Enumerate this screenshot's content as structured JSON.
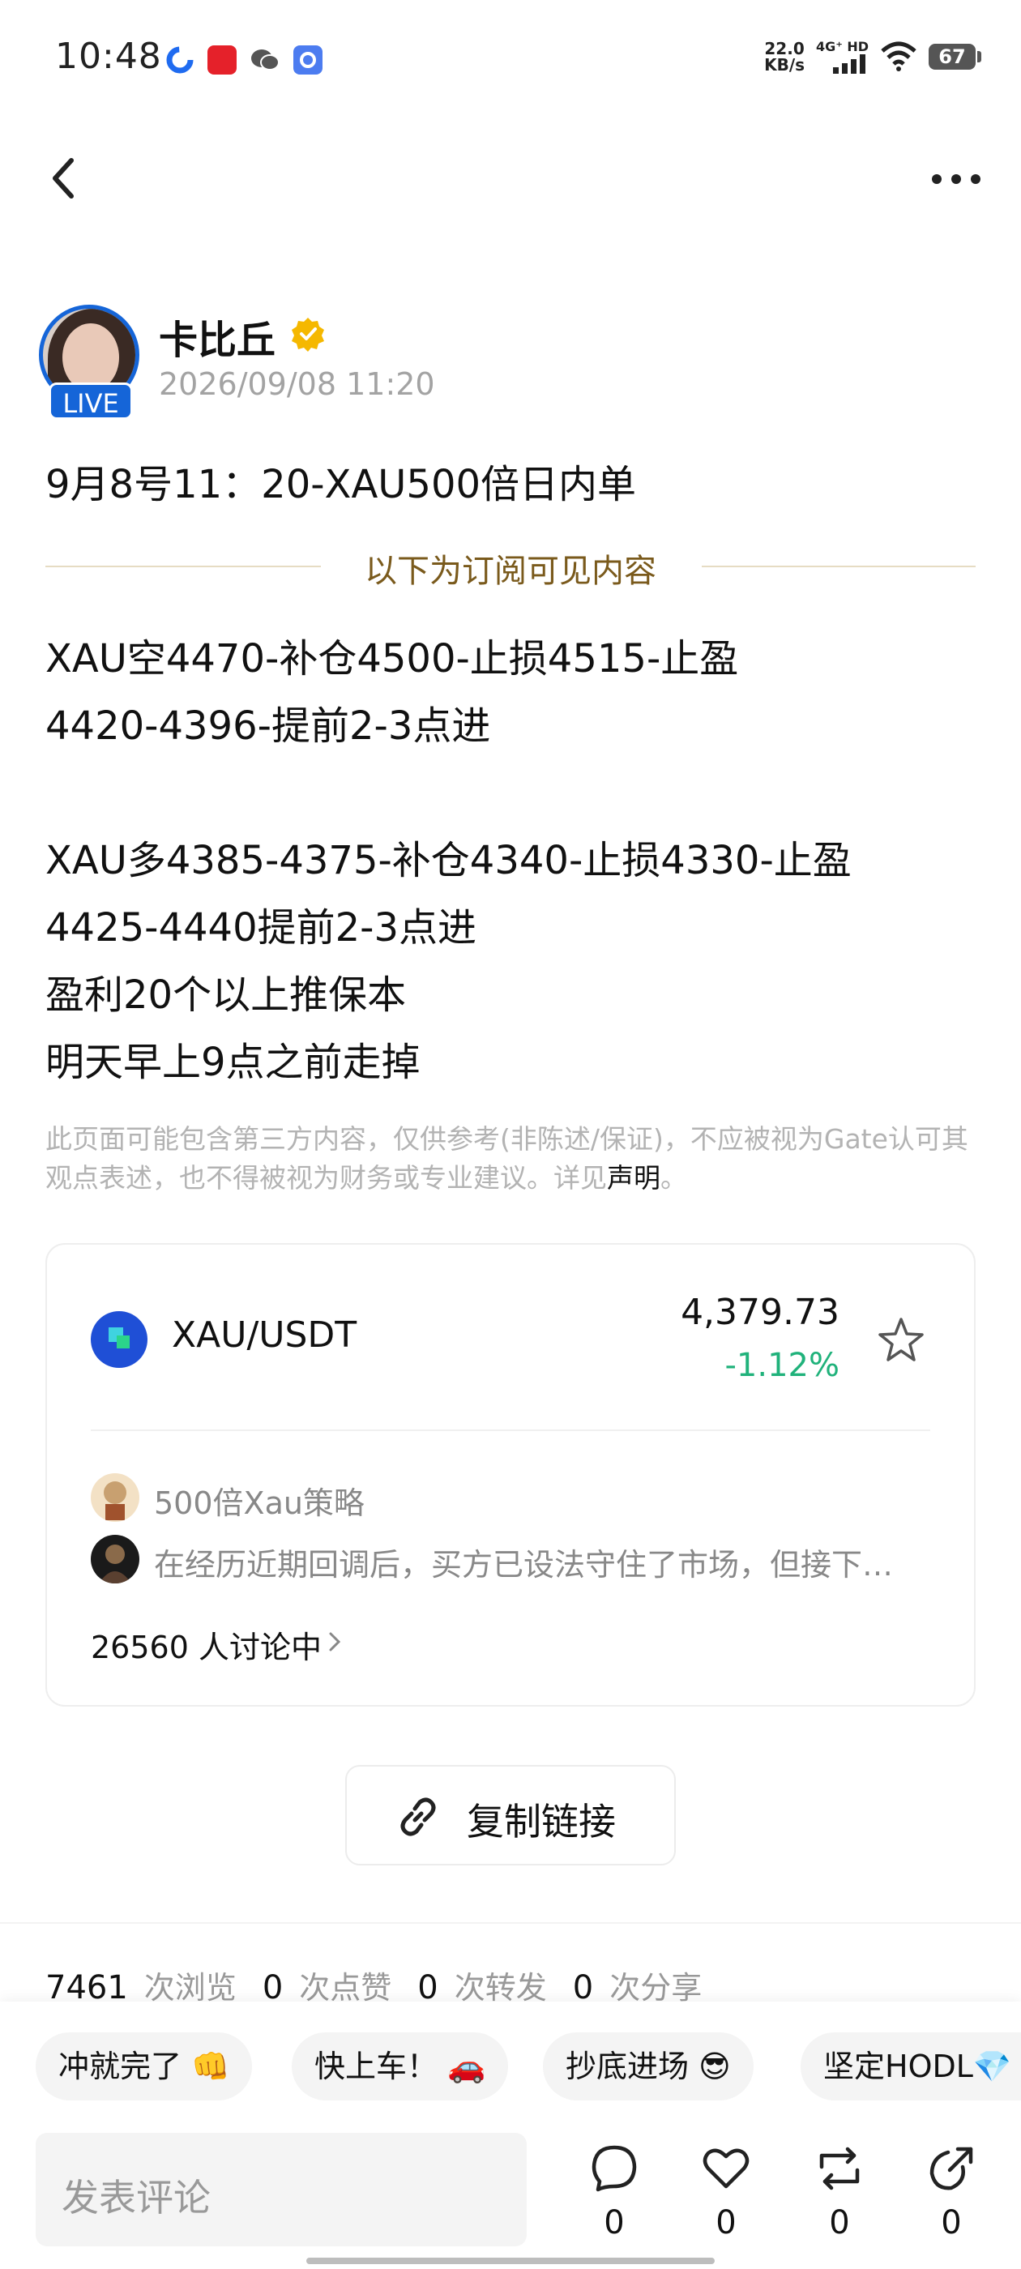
{
  "status_bar": {
    "time": "10:48",
    "speed_value": "22.0",
    "speed_unit": "KB/s",
    "network": "4G⁺ HD",
    "battery": "67"
  },
  "author": {
    "name": "卡比丘",
    "live_badge": "LIVE",
    "post_time": "2026/09/08 11:20"
  },
  "post": {
    "title": "9月8号11：20-XAU500倍日内单",
    "subscription_note": "以下为订阅可见内容",
    "body": "XAU空4470-补仓4500-止损4515-止盈\n4420-4396-提前2-3点进\n\nXAU多4385-4375-补仓4340-止损4330-止盈\n4425-4440提前2-3点进\n盈利20个以上推保本\n明天早上9点之前走掉",
    "disclaimer": "此页面可能包含第三方内容，仅供参考(非陈述/保证)，不应被视为Gate认可其观点表述，也不得被视为财务或专业建议。详见",
    "disclaimer_link": "声明",
    "disclaimer_end": "。"
  },
  "market_card": {
    "pair": "XAU/USDT",
    "price": "4,379.73",
    "change": "-1.12%",
    "strategy_name": "500倍Xau策略",
    "latest_comment": "在经历近期回调后，买方已设法守住了市场，但接下…",
    "discussion": "26560 人讨论中"
  },
  "copy_link": {
    "label": "复制链接"
  },
  "stats": {
    "views": "7461",
    "views_label": "次浏览",
    "likes": "0",
    "likes_label": "次点赞",
    "reposts": "0",
    "reposts_label": "次转发",
    "shares": "0",
    "shares_label": "次分享"
  },
  "quick_replies": [
    "冲就完了 👊",
    "快上车！ 🚗",
    "抄底进场 😎",
    "坚定HODL💎"
  ],
  "comment_bar": {
    "placeholder": "发表评论",
    "comment_count": "0",
    "like_count": "0",
    "repost_count": "0",
    "share_count": "0"
  },
  "colors": {
    "accent_blue": "#1565d8",
    "positive_green": "#20b27b",
    "gold_note": "#7a5a1c",
    "verified_gold": "#f5b800"
  }
}
